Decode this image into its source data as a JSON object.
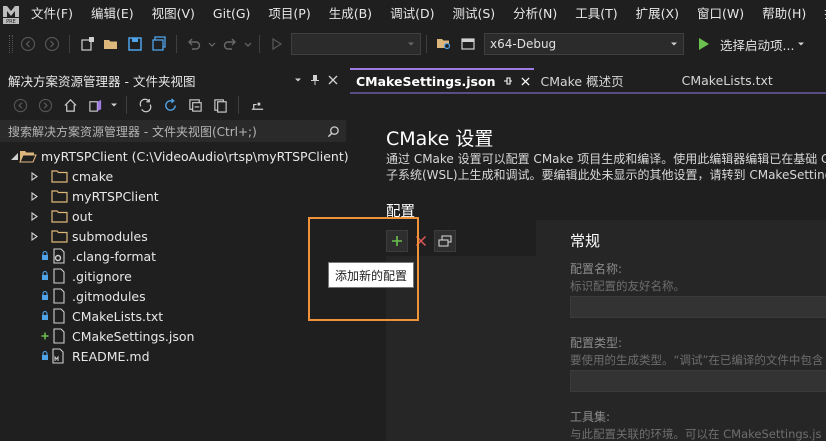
{
  "menubar": {
    "items": [
      "文件(F)",
      "编辑(E)",
      "视图(V)",
      "Git(G)",
      "项目(P)",
      "生成(B)",
      "调试(D)",
      "测试(S)",
      "分析(N)",
      "工具(T)",
      "扩展(X)",
      "窗口(W)",
      "帮助(H)",
      "搜"
    ],
    "logo_badge": "PRE"
  },
  "toolbar": {
    "combo_empty_value": "",
    "config_combo_value": "x64-Debug",
    "run_label": "选择启动项...",
    "icons": [
      "back-icon",
      "forward-icon",
      "new-project-icon",
      "open-folder-icon",
      "save-icon",
      "save-all-icon",
      "undo-icon",
      "redo-icon",
      "start-icon",
      "find-icon",
      "window-icon",
      "play-icon"
    ]
  },
  "explorer": {
    "title": "解决方案资源管理器 - 文件夹视图",
    "search_placeholder": "搜索解决方案资源管理器 - 文件夹视图(Ctrl+;)",
    "tree": [
      {
        "label": "myRTSPClient (C:\\VideoAudio\\rtsp\\myRTSPClient)",
        "type": "folder-open",
        "level": 0,
        "expanded": true
      },
      {
        "label": "cmake",
        "type": "folder",
        "level": 1
      },
      {
        "label": "myRTSPClient",
        "type": "folder",
        "level": 1
      },
      {
        "label": "out",
        "type": "folder",
        "level": 1
      },
      {
        "label": "submodules",
        "type": "folder",
        "level": 1
      },
      {
        "label": ".clang-format",
        "type": "file-settings",
        "level": 1,
        "status": "lock"
      },
      {
        "label": ".gitignore",
        "type": "file",
        "level": 1,
        "status": "lock"
      },
      {
        "label": ".gitmodules",
        "type": "file",
        "level": 1,
        "status": "lock"
      },
      {
        "label": "CMakeLists.txt",
        "type": "file",
        "level": 1,
        "status": "lock"
      },
      {
        "label": "CMakeSettings.json",
        "type": "file",
        "level": 1,
        "status": "add"
      },
      {
        "label": "README.md",
        "type": "file-md",
        "level": 1,
        "status": "lock"
      }
    ]
  },
  "tabs": [
    {
      "label": "CMakeSettings.json",
      "active": true
    },
    {
      "label": "CMake 概述页",
      "active": false
    },
    {
      "label": "CMakeLists.txt",
      "active": false
    }
  ],
  "editor": {
    "title": "CMake 设置",
    "desc_line1": "通过 CMake 设置可以配置 CMake 项目生成和编译。使用此编辑器编辑已在基础 C",
    "desc_line2": "子系统(WSL)上生成和调试。要编辑此处未显示的其他设置，请转到 CMakeSetting",
    "config_heading": "配置",
    "general_title": "常规",
    "fields": [
      {
        "label": "配置名称:",
        "desc": "标识配置的友好名称。"
      },
      {
        "label": "配置类型:",
        "desc": "要使用的生成类型。“调试”在已编译的文件中包含"
      },
      {
        "label": "工具集:",
        "desc": "与此配置关联的环境。可以在 CMakeSettings.js"
      }
    ]
  },
  "tooltip": {
    "text": "添加新的配置"
  },
  "colors": {
    "accent": "#9d7be0",
    "highlight": "#f0923a",
    "add_green": "#6cc14f",
    "remove_red": "#e05757",
    "folder_yellow": "#dcb67a"
  }
}
